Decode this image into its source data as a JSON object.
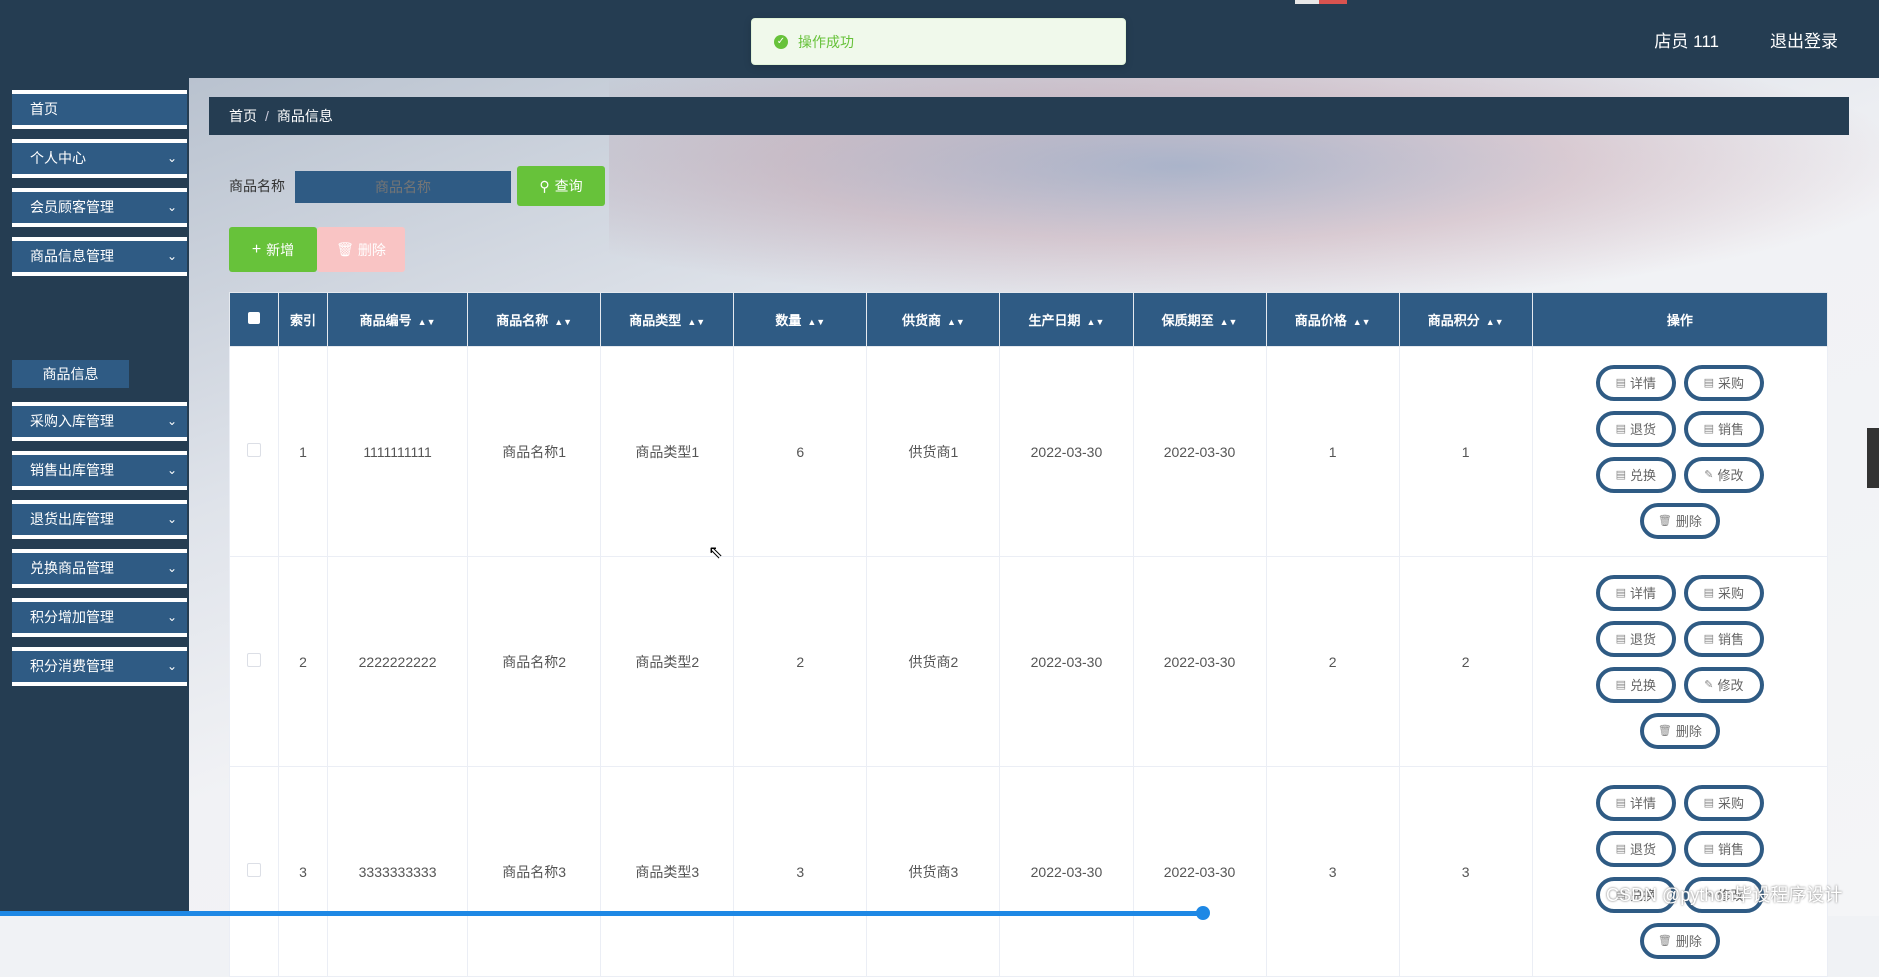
{
  "toast": {
    "message": "操作成功"
  },
  "header": {
    "user": "店员 111",
    "logout": "退出登录"
  },
  "sidebar": {
    "items": [
      {
        "label": "首页",
        "expandable": false
      },
      {
        "label": "个人中心",
        "expandable": true
      },
      {
        "label": "会员顾客管理",
        "expandable": true
      },
      {
        "label": "商品信息管理",
        "expandable": true
      },
      {
        "label": "采购入库管理",
        "expandable": true
      },
      {
        "label": "销售出库管理",
        "expandable": true
      },
      {
        "label": "退货出库管理",
        "expandable": true
      },
      {
        "label": "兑换商品管理",
        "expandable": true
      },
      {
        "label": "积分增加管理",
        "expandable": true
      },
      {
        "label": "积分消费管理",
        "expandable": true
      }
    ],
    "sub_item": "商品信息"
  },
  "breadcrumb": {
    "home": "首页",
    "sep": "/",
    "current": "商品信息"
  },
  "search": {
    "label": "商品名称",
    "placeholder": "商品名称",
    "button": "查询"
  },
  "actions": {
    "add": "新增",
    "delete": "删除"
  },
  "table": {
    "headers": [
      "索引",
      "商品编号",
      "商品名称",
      "商品类型",
      "数量",
      "供货商",
      "生产日期",
      "保质期至",
      "商品价格",
      "商品积分",
      "操作"
    ],
    "rows": [
      {
        "index": "1",
        "code": "1111111111",
        "name": "商品名称1",
        "type": "商品类型1",
        "qty": "6",
        "supplier": "供货商1",
        "produced": "2022-03-30",
        "expires": "2022-03-30",
        "price": "1",
        "points": "1"
      },
      {
        "index": "2",
        "code": "2222222222",
        "name": "商品名称2",
        "type": "商品类型2",
        "qty": "2",
        "supplier": "供货商2",
        "produced": "2022-03-30",
        "expires": "2022-03-30",
        "price": "2",
        "points": "2"
      },
      {
        "index": "3",
        "code": "3333333333",
        "name": "商品名称3",
        "type": "商品类型3",
        "qty": "3",
        "supplier": "供货商3",
        "produced": "2022-03-30",
        "expires": "2022-03-30",
        "price": "3",
        "points": "3"
      }
    ],
    "row_actions": [
      "详情",
      "采购",
      "退货",
      "销售",
      "兑换",
      "修改",
      "删除"
    ]
  },
  "watermark": "CSDN @python毕设程序设计",
  "colors": {
    "header": "#253d52",
    "accent": "#2f5b84",
    "success": "#67c23a",
    "danger_light": "#f9c4c4"
  }
}
